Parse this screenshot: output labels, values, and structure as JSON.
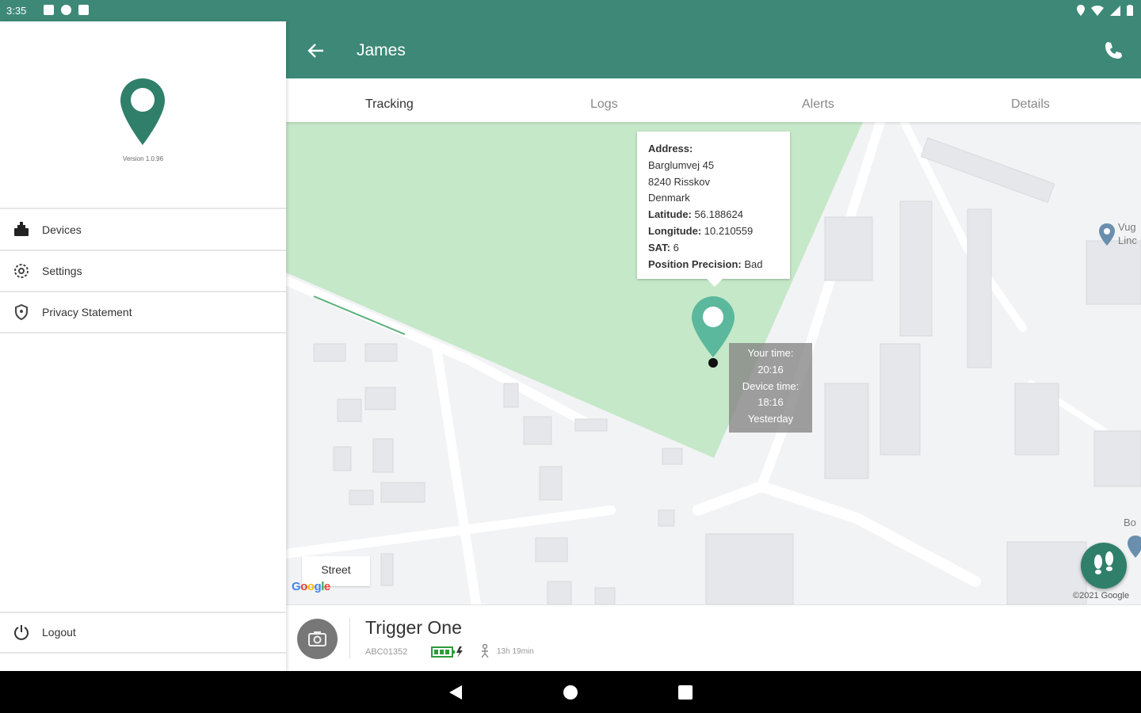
{
  "status_bar": {
    "time": "3:35",
    "left_icons": [
      "notification-icon",
      "notification-icon",
      "shop-icon",
      "sd-card-icon"
    ],
    "right_icons": [
      "location-icon",
      "wifi-icon",
      "signal-icon",
      "battery-icon"
    ]
  },
  "drawer": {
    "version": "Version 1.0.96",
    "items": [
      {
        "label": "Devices",
        "icon": "devices-icon"
      },
      {
        "label": "Settings",
        "icon": "settings-icon"
      },
      {
        "label": "Privacy Statement",
        "icon": "shield-icon"
      }
    ],
    "logout": {
      "label": "Logout",
      "icon": "power-icon"
    }
  },
  "app_bar": {
    "title": "James",
    "back_icon": "arrow-back-icon",
    "action_icon": "phone-icon"
  },
  "tabs": [
    {
      "label": "Tracking",
      "active": true
    },
    {
      "label": "Logs",
      "active": false
    },
    {
      "label": "Alerts",
      "active": false
    },
    {
      "label": "Details",
      "active": false
    }
  ],
  "map": {
    "info": {
      "address_label": "Address:",
      "address_lines": [
        "Barglumvej 45",
        "8240 Risskov",
        "Denmark"
      ],
      "latitude_label": "Latitude:",
      "latitude": "56.188624",
      "longitude_label": "Longitude:",
      "longitude": "10.210559",
      "sat_label": "SAT:",
      "sat": "6",
      "precision_label": "Position Precision:",
      "precision": "Bad"
    },
    "time_box": {
      "your_time_label": "Your time:",
      "your_time": "20:16",
      "device_time_label": "Device time:",
      "device_time": "18:16",
      "day": "Yesterday"
    },
    "street_button": "Street",
    "google_logo": "Google",
    "copyright": "©2021 Google",
    "place1_line1": "Vug",
    "place1_line2": "Linc",
    "place2": "Bo",
    "fab_icon": "footsteps-icon",
    "colors": {
      "geofence": "#c5e8c8",
      "marker": "#5bb89c",
      "fab": "#2f7f6b"
    }
  },
  "device": {
    "name": "Trigger One",
    "id": "ABC01352",
    "duration": "13h 19min",
    "camera_icon": "camera-icon",
    "battery_icon": "battery-charging-icon",
    "walk_icon": "walking-icon"
  },
  "nav_bar": {
    "back": "nav-back-icon",
    "home": "nav-home-icon",
    "recents": "nav-recents-icon"
  },
  "colors": {
    "primary": "#3d8877",
    "accent": "#2f7f6b"
  }
}
